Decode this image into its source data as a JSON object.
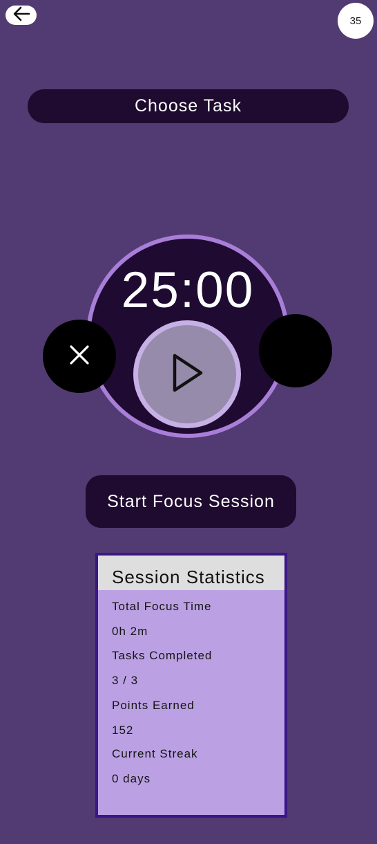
{
  "header": {
    "back_icon": "arrow-left-icon",
    "points_badge": "35"
  },
  "task": {
    "choose_label": "Choose Task"
  },
  "timer": {
    "display": "25:00",
    "play_icon": "play-icon",
    "cancel_icon": "close-icon"
  },
  "actions": {
    "start_label": "Start Focus Session"
  },
  "stats": {
    "title": "Session Statistics",
    "items": [
      {
        "label": "Total Focus Time",
        "value": "0h 2m"
      },
      {
        "label": "Tasks Completed",
        "value": "3 / 3"
      },
      {
        "label": "Points Earned",
        "value": "152"
      },
      {
        "label": "Current Streak",
        "value": "0 days"
      }
    ]
  },
  "colors": {
    "background": "#513b72",
    "dark_surface": "#1e0b2f",
    "ring": "#a97ed8",
    "play_outer": "#c6b0e6",
    "play_inner": "#968baa",
    "stats_bg": "#bba1e3",
    "stats_border": "#3a1784",
    "stats_header": "#dedede"
  }
}
